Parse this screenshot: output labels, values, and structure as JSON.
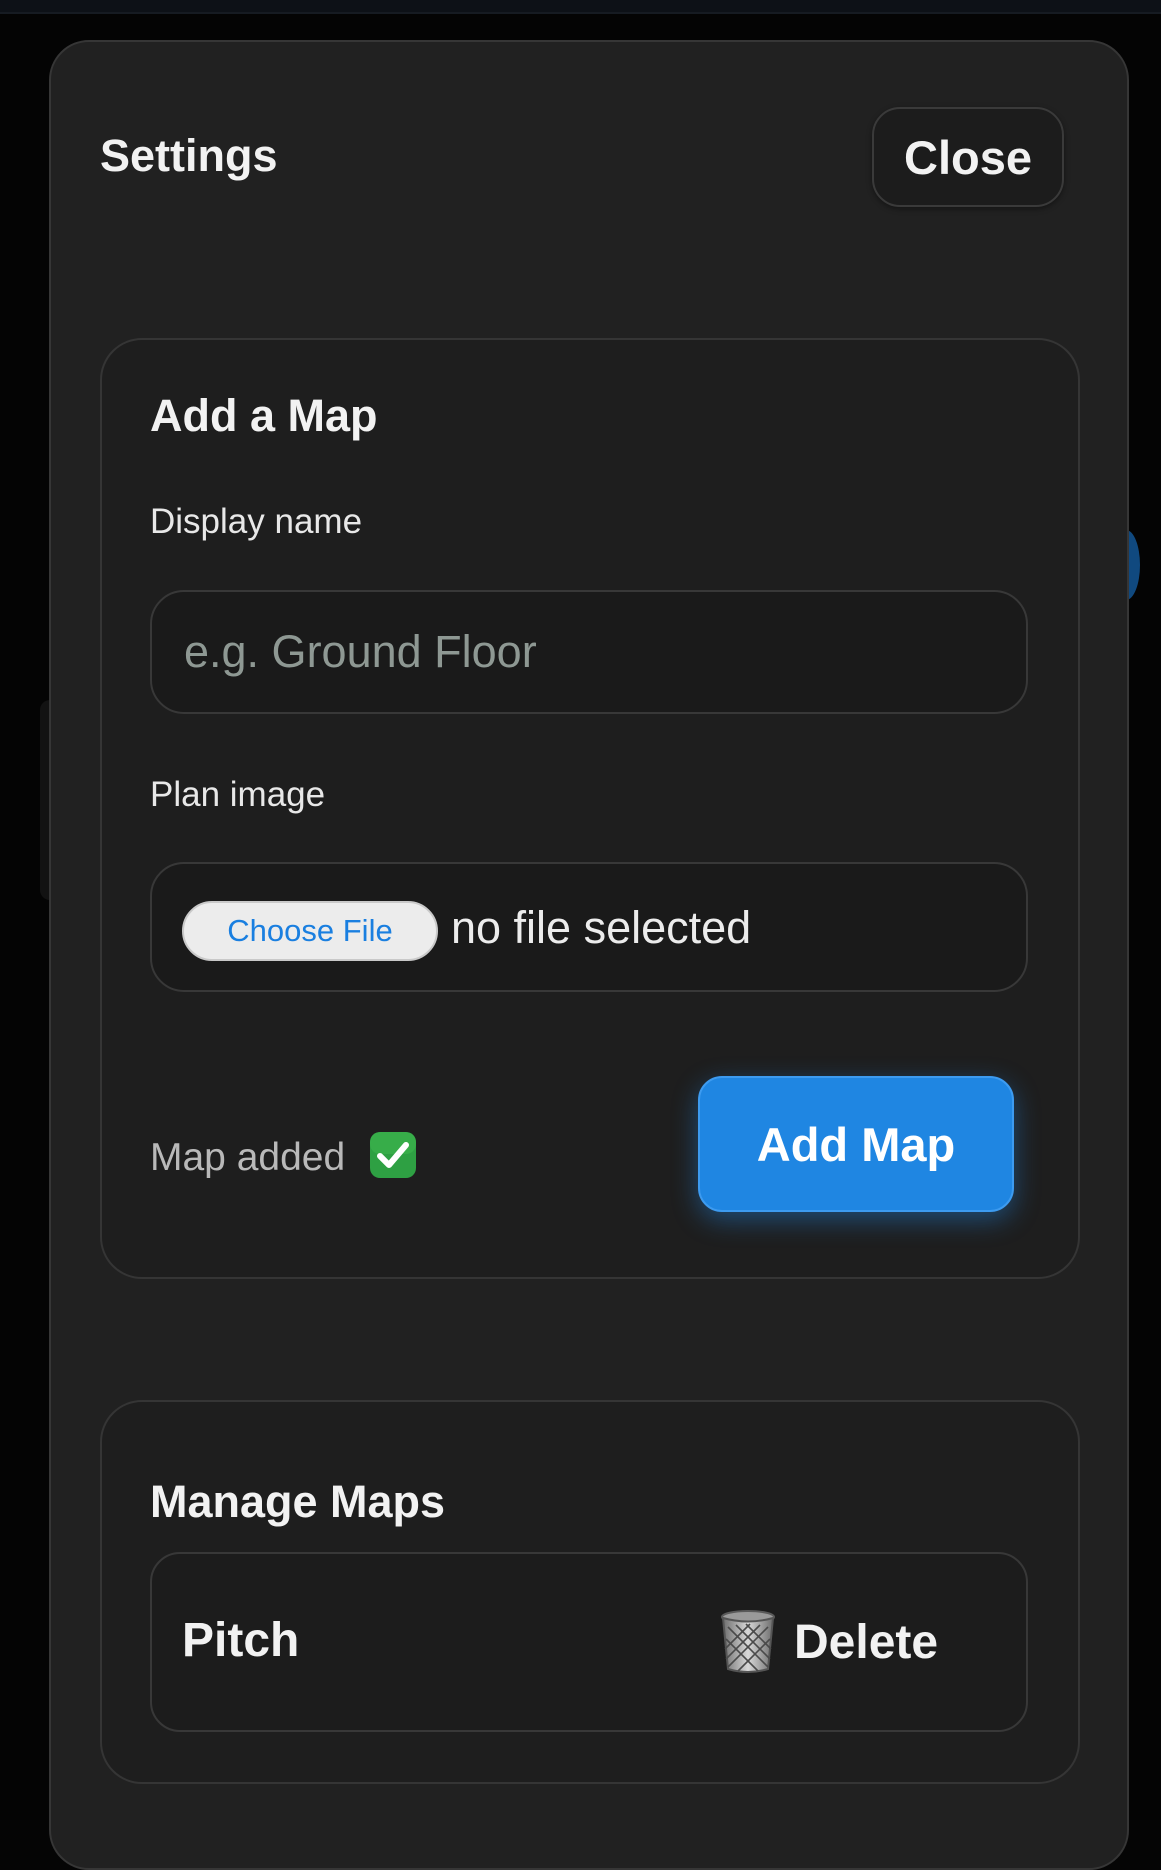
{
  "modal": {
    "title": "Settings",
    "close_label": "Close"
  },
  "add_map": {
    "title": "Add a Map",
    "display_name_label": "Display name",
    "display_name_value": "",
    "display_name_placeholder": "e.g. Ground Floor",
    "plan_image_label": "Plan image",
    "choose_file_label": "Choose File",
    "file_status": "no file selected",
    "status_message": "Map added",
    "status_icon": "check-mark-icon",
    "submit_label": "Add Map"
  },
  "manage_maps": {
    "title": "Manage Maps",
    "maps": [
      {
        "name": "Pitch",
        "delete_label": "Delete",
        "delete_icon": "trash-icon"
      }
    ]
  },
  "colors": {
    "accent": "#1f86e2",
    "modal_background": "#212121",
    "card_background": "#1e1e1e",
    "check_green": "#2ea043"
  }
}
